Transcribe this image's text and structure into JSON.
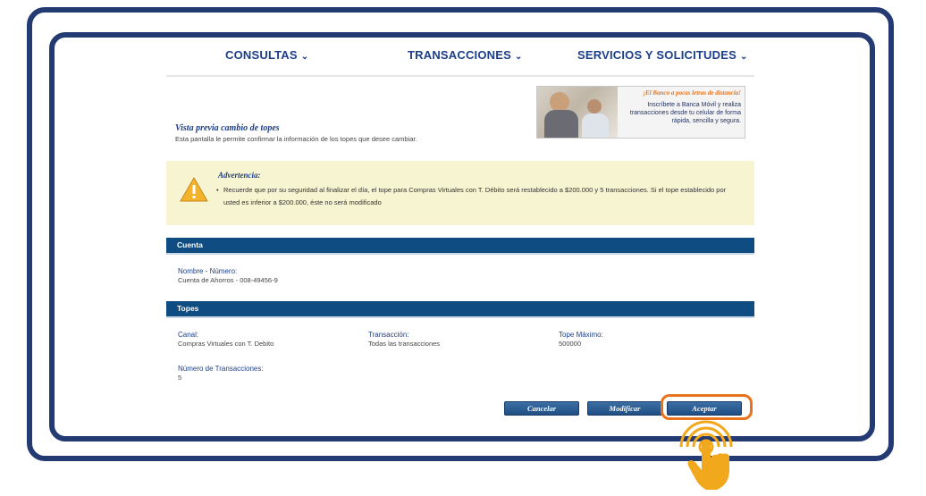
{
  "nav": {
    "consultas": "CONSULTAS",
    "transacciones": "TRANSACCIONES",
    "servicios": "SERVICIOS Y SOLICITUDES"
  },
  "banner": {
    "headline": "¡El Banco a pocas letras de distancia!",
    "body": "Inscríbete a Banca Móvil y realiza transacciones desde tu celular de forma rápida, sencilla y segura."
  },
  "page": {
    "title": "Vista previa cambio de topes",
    "subtitle": "Esta pantalla le permite confirmar la información de los topes que desee cambiar."
  },
  "warning": {
    "title": "Advertencia:",
    "text": "Recuerde que por su seguridad al finalizar el día, el tope para Compras Virtuales con T. Débito será restablecido a $200.000 y 5 transacciones. Si el tope establecido por usted es inferior a $200.000, éste no será modificado"
  },
  "cuenta": {
    "header": "Cuenta",
    "label": "Nombre - Número:",
    "value": "Cuenta de Ahorros - 008-49456-9"
  },
  "topes": {
    "header": "Topes",
    "canal_label": "Canal:",
    "canal_value": "Compras Virtuales con T. Debito",
    "transaccion_label": "Transacción:",
    "transaccion_value": "Todas las transacciones",
    "tope_label": "Tope Máximo:",
    "tope_value": "500000",
    "num_label": "Número de Transacciones:",
    "num_value": "5"
  },
  "buttons": {
    "cancelar": "Cancelar",
    "modificar": "Modificar",
    "aceptar": "Aceptar"
  },
  "colors": {
    "frame": "#243a73",
    "section_bar": "#0f4c81",
    "highlight": "#e8731c",
    "warning_bg": "#f7f4d2",
    "hand": "#f2a81d"
  }
}
